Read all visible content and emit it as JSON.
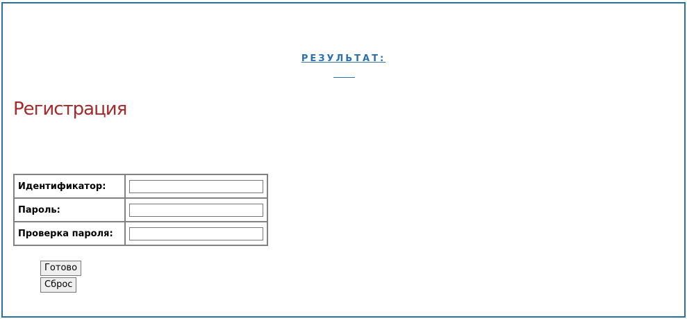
{
  "result": {
    "heading": "РЕЗУЛЬТАТ:",
    "value": ""
  },
  "page": {
    "title": "Регистрация"
  },
  "form": {
    "rows": [
      {
        "label": "Идентификатор:",
        "value": ""
      },
      {
        "label": "Пароль:",
        "value": ""
      },
      {
        "label": "Проверка пароля:",
        "value": ""
      }
    ],
    "submit_label": "Готово",
    "reset_label": "Сброс"
  },
  "colors": {
    "frame_border": "#2a6f9e",
    "result_heading": "#2a6fb0",
    "title": "#a52a2a"
  }
}
